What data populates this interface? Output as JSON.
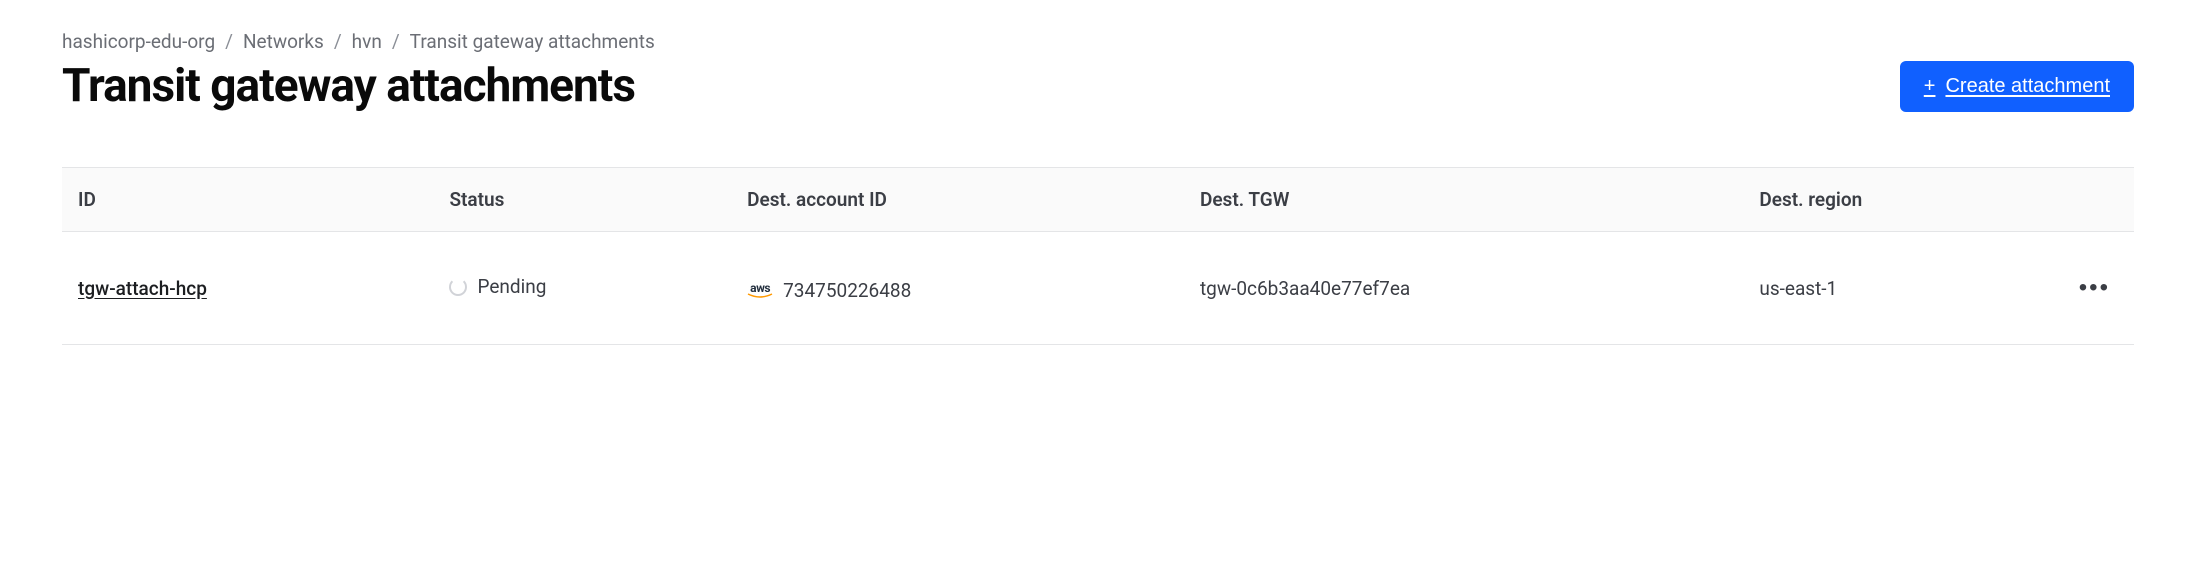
{
  "breadcrumb": {
    "items": [
      "hashicorp-edu-org",
      "Networks",
      "hvn",
      "Transit gateway attachments"
    ]
  },
  "header": {
    "title": "Transit gateway attachments",
    "create_label": "Create attachment"
  },
  "table": {
    "columns": {
      "id": "ID",
      "status": "Status",
      "dest_account": "Dest. account ID",
      "dest_tgw": "Dest. TGW",
      "dest_region": "Dest. region"
    },
    "rows": [
      {
        "id": "tgw-attach-hcp",
        "status": "Pending",
        "provider": "aws",
        "dest_account": "734750226488",
        "dest_tgw": "tgw-0c6b3aa40e77ef7ea",
        "dest_region": "us-east-1"
      }
    ]
  }
}
